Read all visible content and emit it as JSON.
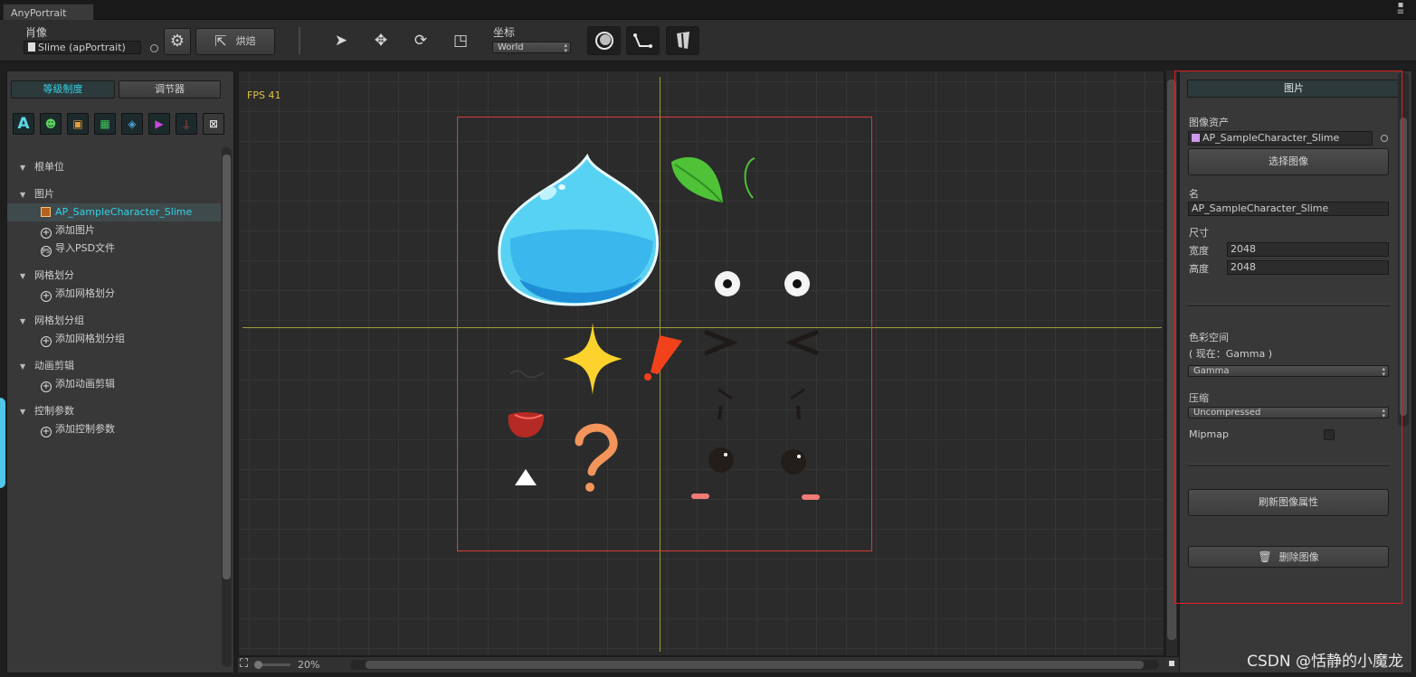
{
  "window": {
    "tab_title": "AnyPortrait",
    "menu_glyph": "▪ ≡"
  },
  "toolbar": {
    "portrait_label": "肖像",
    "portrait_field": "Slime (apPortrait)",
    "bake_label": "烘焙",
    "coord_label": "坐标",
    "coord_value": "World",
    "tools": [
      "select-tool",
      "move-tool",
      "rotate-tool",
      "scale-tool"
    ]
  },
  "left_panel": {
    "tabs": [
      {
        "label": "等级制度",
        "active": true
      },
      {
        "label": "调节器",
        "active": false
      }
    ],
    "icon_buttons": [
      "text-icon",
      "character-icon",
      "image-icon",
      "mesh-icon",
      "mesh-group-icon",
      "animation-icon",
      "control-param-icon",
      "close-box-icon"
    ],
    "tree": [
      {
        "type": "header",
        "label": "根单位"
      },
      {
        "type": "header",
        "label": "图片"
      },
      {
        "type": "image",
        "label": "AP_SampleCharacter_Slime",
        "selected": true
      },
      {
        "type": "add",
        "label": "添加图片"
      },
      {
        "type": "psd",
        "label": "导入PSD文件"
      },
      {
        "type": "header",
        "label": "网格划分"
      },
      {
        "type": "add",
        "label": "添加网格划分"
      },
      {
        "type": "header",
        "label": "网格划分组"
      },
      {
        "type": "add",
        "label": "添加网格划分组"
      },
      {
        "type": "header",
        "label": "动画剪辑"
      },
      {
        "type": "add",
        "label": "添加动画剪辑"
      },
      {
        "type": "header",
        "label": "控制参数"
      },
      {
        "type": "add",
        "label": "添加控制参数"
      }
    ]
  },
  "canvas": {
    "fps": "FPS 41",
    "zoom": "20%",
    "colors": {
      "axis": "#9c9b3a",
      "bounds": "#d93a3a",
      "fps": "#e3c23e"
    }
  },
  "right_panel": {
    "title": "图片",
    "asset_label": "图像资产",
    "asset_value": "AP_SampleCharacter_Slime",
    "select_image_button": "选择图像",
    "name_label": "名",
    "name_value": "AP_SampleCharacter_Slime",
    "size_label": "尺寸",
    "width_label": "宽度",
    "width_value": "2048",
    "height_label": "高度",
    "height_value": "2048",
    "colorspace_label": "色彩空间",
    "colorspace_current": "( 现在：Gamma )",
    "colorspace_value": "Gamma",
    "compression_label": "压缩",
    "compression_value": "Uncompressed",
    "mipmap_label": "Mipmap",
    "mipmap_checked": false,
    "refresh_button": "刷新图像属性",
    "delete_button": "删除图像"
  },
  "watermark": "CSDN @恬静的小魔龙"
}
